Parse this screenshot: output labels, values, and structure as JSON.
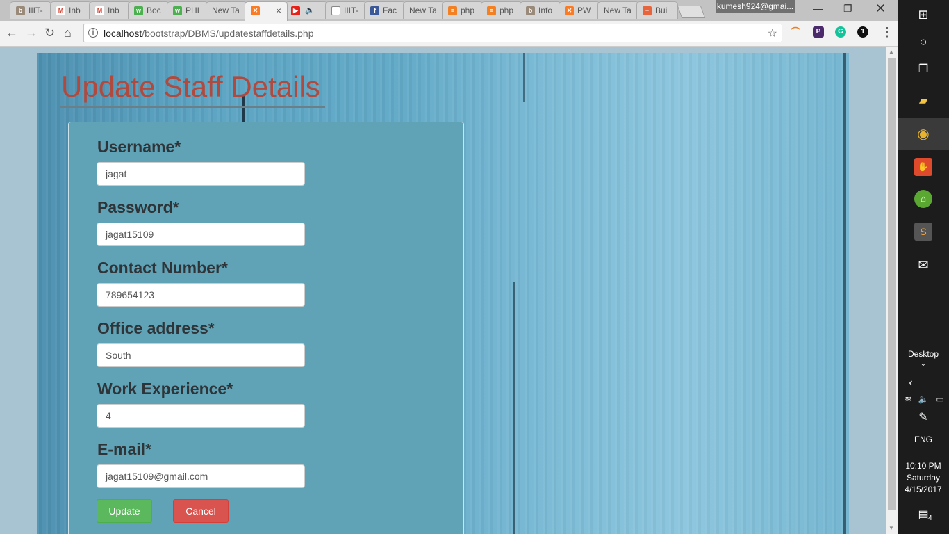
{
  "browser": {
    "tabs": [
      {
        "title": "IIIT-",
        "icon": "bookpark-icon",
        "color": "#9a8a7a"
      },
      {
        "title": "Inb",
        "icon": "gmail-icon",
        "color": "#d44638"
      },
      {
        "title": "Inb",
        "icon": "gmail-icon",
        "color": "#d44638"
      },
      {
        "title": "Boc",
        "icon": "w3schools-icon",
        "color": "#4caf50"
      },
      {
        "title": "PHI",
        "icon": "w3schools-icon",
        "color": "#4caf50"
      },
      {
        "title": "New Ta",
        "icon": "",
        "color": ""
      },
      {
        "title": "",
        "icon": "xampp-icon",
        "color": "#fb7a24",
        "active": true
      },
      {
        "title": "",
        "icon": "youtube-icon",
        "color": "#e62117"
      },
      {
        "title": "IIIT-",
        "icon": "document-icon",
        "color": "#888"
      },
      {
        "title": "Fac",
        "icon": "facebook-icon",
        "color": "#3b5998"
      },
      {
        "title": "New Ta",
        "icon": "",
        "color": ""
      },
      {
        "title": "php",
        "icon": "stackoverflow-icon",
        "color": "#f48024"
      },
      {
        "title": "php",
        "icon": "stackoverflow-icon",
        "color": "#f48024"
      },
      {
        "title": "Info",
        "icon": "bookpark-icon",
        "color": "#9a8a7a"
      },
      {
        "title": "PW",
        "icon": "xampp-icon",
        "color": "#fb7a24"
      },
      {
        "title": "New Ta",
        "icon": "",
        "color": ""
      },
      {
        "title": "Bui",
        "icon": "plus-icon",
        "color": "#e8643c"
      }
    ],
    "profile_name": "kumesh924@gmai...",
    "url_host": "localhost",
    "url_path": "/bootstrap/DBMS/updatestaffdetails.php"
  },
  "page": {
    "title": "Update Staff Details",
    "fields": [
      {
        "label": "Username*",
        "value": "jagat"
      },
      {
        "label": "Password*",
        "value": "jagat15109"
      },
      {
        "label": "Contact Number*",
        "value": "789654123"
      },
      {
        "label": "Office address*",
        "value": "South"
      },
      {
        "label": "Work Experience*",
        "value": "4"
      },
      {
        "label": "E-mail*",
        "value": "jagat15109@gmail.com"
      }
    ],
    "update_label": "Update",
    "cancel_label": "Cancel",
    "colors": {
      "title": "#b14a3e",
      "update": "#5cb85c",
      "cancel": "#d9534f",
      "panel": "#60a3b6"
    }
  },
  "taskbar": {
    "desktop_label": "Desktop",
    "language": "ENG",
    "time": "10:10 PM",
    "day": "Saturday",
    "date": "4/15/2017",
    "notification_count": "4"
  }
}
